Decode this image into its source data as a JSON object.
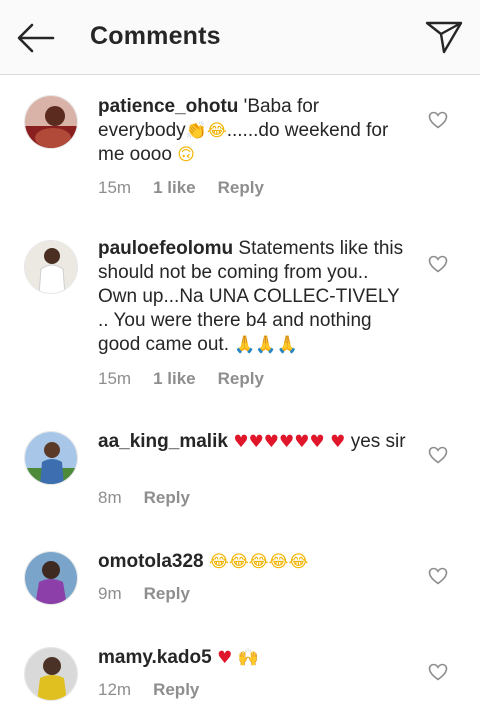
{
  "header": {
    "title": "Comments"
  },
  "comments": [
    {
      "username": "patience_ohotu",
      "text_1": " 'Baba for everybody",
      "emoji_1": "👏😂",
      "text_2": "......do weekend for me oooo ",
      "emoji_2": "🙃",
      "time": "15m",
      "likes": "1 like",
      "reply": "Reply"
    },
    {
      "username": "pauloefeolomu",
      "text_1": " Statements like this should not be coming from you.. Own up...Na UNA COLLEC-TIVELY .. You were there b4 and nothing good came out. ",
      "emoji_1": "🙏🙏🙏",
      "time": "15m",
      "likes": "1 like",
      "reply": "Reply"
    },
    {
      "username": "aa_king_malik",
      "emoji_1": " ♥♥♥♥♥♥ ♥",
      "text_1": " yes sir",
      "time": "8m",
      "reply": "Reply"
    },
    {
      "username": "omotola328",
      "emoji_1": " 😂😂😂😂😂",
      "time": "9m",
      "reply": "Reply"
    },
    {
      "username": "mamy.kado5",
      "emoji_1": " ♥",
      "emoji_2": "🙌",
      "time": "12m",
      "reply": "Reply"
    }
  ]
}
